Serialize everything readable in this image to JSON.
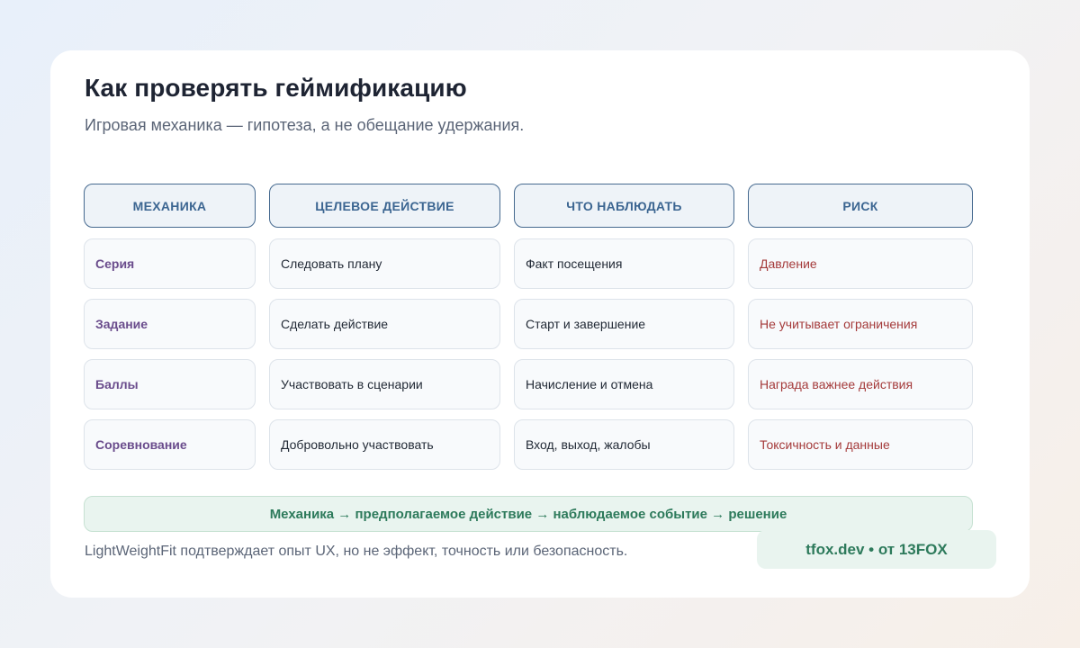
{
  "title": "Как проверять геймификацию",
  "subtitle": "Игровая механика — гипотеза, а не обещание удержания.",
  "table": {
    "headers": [
      "МЕХАНИКА",
      "ЦЕЛЕВОЕ ДЕЙСТВИЕ",
      "ЧТО НАБЛЮДАТЬ",
      "РИСК"
    ],
    "rows": [
      [
        "Серия",
        "Следовать плану",
        "Факт посещения",
        "Давление"
      ],
      [
        "Задание",
        "Сделать действие",
        "Старт и завершение",
        "Не учитывает ограничения"
      ],
      [
        "Баллы",
        "Участвовать в сценарии",
        "Начисление и отмена",
        "Награда важнее действия"
      ],
      [
        "Соревнование",
        "Добровольно участвовать",
        "Вход, выход, жалобы",
        "Токсичность и данные"
      ]
    ]
  },
  "flow": "Механика → предполагаемое действие → наблюдаемое событие → решение",
  "footnote": "LightWeightFit подтверждает опыт UX, но не эффект, точность или безопасность.",
  "brand": "tfox.dev • от 13FOX",
  "colors": {
    "header_border": "#45698f",
    "header_text": "#3b6591",
    "mechanic_text": "#6a4c8c",
    "risk_text": "#a43a3a",
    "accent_green": "#2d7a5b"
  }
}
